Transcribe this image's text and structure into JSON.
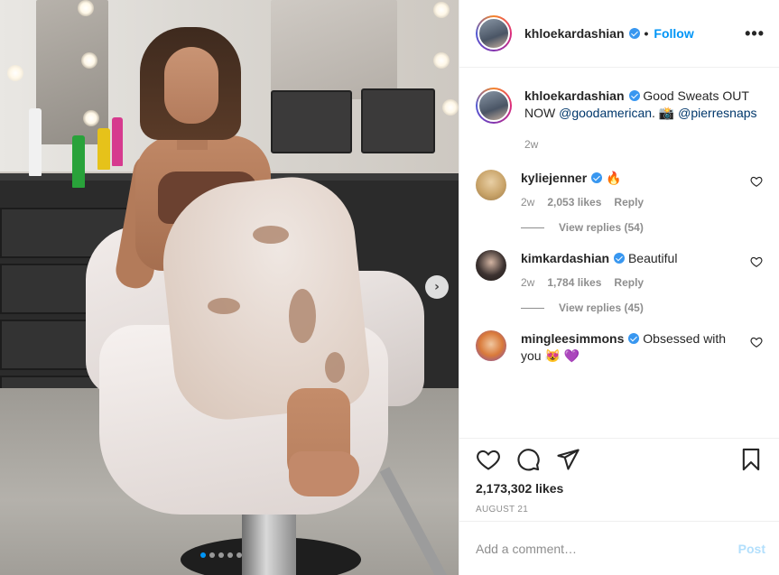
{
  "post": {
    "username": "khloekardashian",
    "follow_label": "Follow",
    "bullet": "•",
    "more_icon": "more-options-icon",
    "caption": {
      "username": "khloekardashian",
      "text_before": "Good Sweats OUT NOW ",
      "mention1": "@goodamerican",
      "text_mid": ". 📸 ",
      "mention2": "@pierresnaps",
      "time": "2w"
    },
    "comments": [
      {
        "username": "kyliejenner",
        "text": "🔥",
        "time": "2w",
        "likes": "2,053 likes",
        "reply_label": "Reply",
        "view_replies": "View replies (54)",
        "avatar_color": "#c9a46a"
      },
      {
        "username": "kimkardashian",
        "text": "Beautiful",
        "time": "2w",
        "likes": "1,784 likes",
        "reply_label": "Reply",
        "view_replies": "View replies (45)",
        "avatar_color": "#3c3230"
      },
      {
        "username": "mingleesimmons",
        "text": "Obsessed with you 😻 💜",
        "avatar_color": "#d97a3a"
      }
    ],
    "like_count": "2,173,302 likes",
    "date": "AUGUST 21",
    "comment_placeholder": "Add a comment…",
    "post_label": "Post",
    "carousel": {
      "total": 5,
      "active_index": 0
    }
  },
  "colors": {
    "accent": "#0095f6",
    "verified": "#3897f0",
    "muted": "#8e8e8e",
    "post_disabled": "#b2dffc"
  }
}
